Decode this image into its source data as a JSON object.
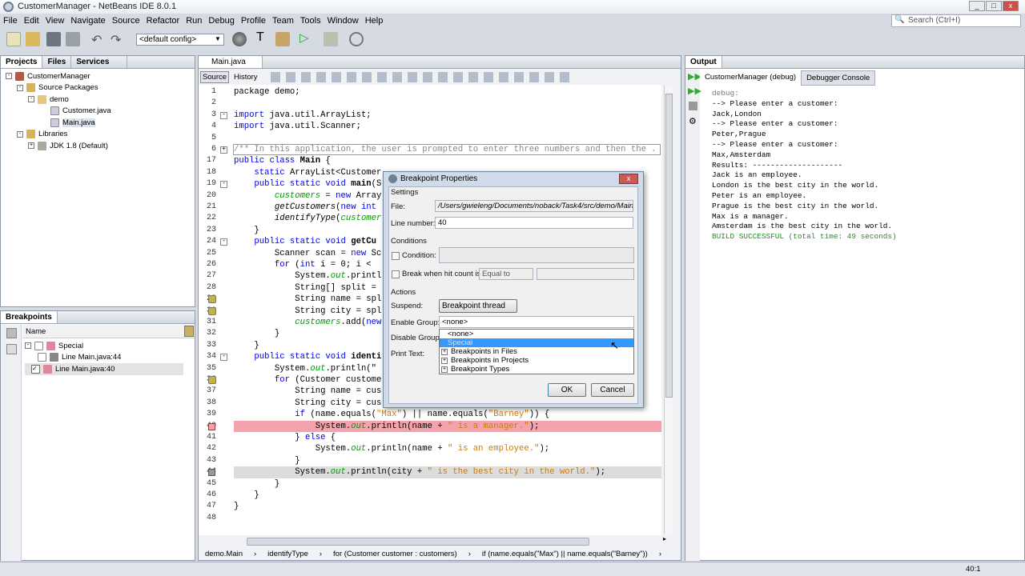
{
  "window": {
    "title": "CustomerManager - NetBeans IDE 8.0.1",
    "search_placeholder": "Search (Ctrl+I)"
  },
  "menu": [
    "File",
    "Edit",
    "View",
    "Navigate",
    "Source",
    "Refactor",
    "Run",
    "Debug",
    "Profile",
    "Team",
    "Tools",
    "Window",
    "Help"
  ],
  "toolbar": {
    "config": "<default config>"
  },
  "projects": {
    "tabs": [
      "Projects",
      "Files",
      "Services"
    ],
    "tree": [
      "CustomerManager",
      "Source Packages",
      "demo",
      "Customer.java",
      "Main.java",
      "Libraries",
      "JDK 1.8 (Default)"
    ]
  },
  "breakpoints": {
    "title": "Breakpoints",
    "column": "Name",
    "items": [
      "Special",
      "Line Main.java:44",
      "Line Main.java:40"
    ]
  },
  "editor": {
    "tab": "Main.java",
    "source_tab": "Source",
    "history_tab": "History",
    "lines": [
      {
        "n": "1",
        "s": [
          [
            "package demo;",
            ""
          ]
        ]
      },
      {
        "n": "2",
        "s": []
      },
      {
        "n": "3",
        "f": "-",
        "s": [
          [
            "import",
            "kw"
          ],
          [
            " java.util.ArrayList;",
            ""
          ]
        ]
      },
      {
        "n": "4",
        "s": [
          [
            "import",
            "kw"
          ],
          [
            " java.util.Scanner;",
            ""
          ]
        ]
      },
      {
        "n": "5",
        "s": []
      },
      {
        "n": "6",
        "f": "+",
        "box": true,
        "s": [
          [
            "/** In this application, the user is prompted to enter three numbers and then the .",
            "cm"
          ]
        ]
      },
      {
        "n": "17",
        "s": [
          [
            "public class ",
            "kw"
          ],
          [
            "Main",
            "b"
          ],
          [
            " {",
            ""
          ]
        ]
      },
      {
        "n": "18",
        "s": [
          [
            "    static ",
            "kw"
          ],
          [
            "ArrayList<Customer",
            ""
          ]
        ]
      },
      {
        "n": "19",
        "f": "-",
        "s": [
          [
            "    public static void ",
            "kw"
          ],
          [
            "main",
            "b"
          ],
          [
            "(S",
            ""
          ]
        ]
      },
      {
        "n": "20",
        "s": [
          [
            "        ",
            ""
          ],
          [
            "customers",
            "fd"
          ],
          [
            " = ",
            ""
          ],
          [
            "new",
            "kw"
          ],
          [
            " Array",
            ""
          ]
        ]
      },
      {
        "n": "21",
        "s": [
          [
            "        ",
            ""
          ],
          [
            "getCustomers",
            "it"
          ],
          [
            "(",
            ""
          ],
          [
            "new int",
            "kw"
          ]
        ]
      },
      {
        "n": "22",
        "s": [
          [
            "        ",
            ""
          ],
          [
            "identifyType",
            "it"
          ],
          [
            "(",
            ""
          ],
          [
            "customer",
            "fd"
          ]
        ]
      },
      {
        "n": "23",
        "s": [
          [
            "    }",
            ""
          ]
        ]
      },
      {
        "n": "24",
        "f": "-",
        "s": [
          [
            "    public static void ",
            "kw"
          ],
          [
            "getCu",
            "b"
          ]
        ]
      },
      {
        "n": "25",
        "s": [
          [
            "        Scanner scan = ",
            ""
          ],
          [
            "new",
            "kw"
          ],
          [
            " Sc",
            ""
          ]
        ]
      },
      {
        "n": "26",
        "s": [
          [
            "        ",
            ""
          ],
          [
            "for",
            "kw"
          ],
          [
            " (",
            ""
          ],
          [
            "int",
            "kw"
          ],
          [
            " i = 0; i < ",
            ""
          ]
        ]
      },
      {
        "n": "27",
        "s": [
          [
            "            System.",
            ""
          ],
          [
            "out",
            "fd"
          ],
          [
            ".printl",
            ""
          ]
        ]
      },
      {
        "n": "28",
        "s": [
          [
            "            String[] split = ",
            ""
          ]
        ]
      },
      {
        "n": "29",
        "g": "cond",
        "s": [
          [
            "            String name = spl",
            ""
          ]
        ]
      },
      {
        "n": "30",
        "g": "cond",
        "s": [
          [
            "            String city = spl",
            ""
          ]
        ]
      },
      {
        "n": "31",
        "s": [
          [
            "            ",
            ""
          ],
          [
            "customers",
            "fd"
          ],
          [
            ".add(",
            ""
          ],
          [
            "new",
            "kw"
          ]
        ]
      },
      {
        "n": "32",
        "s": [
          [
            "        }",
            ""
          ]
        ]
      },
      {
        "n": "33",
        "s": [
          [
            "    }",
            ""
          ]
        ]
      },
      {
        "n": "34",
        "f": "-",
        "s": [
          [
            "    public static void ",
            "kw"
          ],
          [
            "identi",
            "b"
          ]
        ]
      },
      {
        "n": "35",
        "s": [
          [
            "        System.",
            ""
          ],
          [
            "out",
            "fd"
          ],
          [
            ".println(\"",
            ""
          ]
        ]
      },
      {
        "n": "36",
        "g": "cond",
        "s": [
          [
            "        ",
            ""
          ],
          [
            "for",
            "kw"
          ],
          [
            " (Customer custome",
            ""
          ]
        ]
      },
      {
        "n": "37",
        "s": [
          [
            "            String name = cus",
            ""
          ]
        ]
      },
      {
        "n": "38",
        "s": [
          [
            "            String city = cus",
            ""
          ]
        ]
      },
      {
        "n": "39",
        "s": [
          [
            "            ",
            ""
          ],
          [
            "if",
            "kw"
          ],
          [
            " (name.equals(",
            ""
          ],
          [
            "\"Max\"",
            "st"
          ],
          [
            ") || name.equals(",
            ""
          ],
          [
            "\"Barney\"",
            "st"
          ],
          [
            ")) {",
            ""
          ]
        ]
      },
      {
        "n": "40",
        "g": "bp",
        "hl": "bp",
        "s": [
          [
            "                System.",
            ""
          ],
          [
            "out",
            "fd"
          ],
          [
            ".println(name + ",
            ""
          ],
          [
            "\" is a manager.\"",
            "st"
          ],
          [
            ");",
            ""
          ]
        ]
      },
      {
        "n": "41",
        "s": [
          [
            "            } ",
            ""
          ],
          [
            "else",
            "kw"
          ],
          [
            " {",
            ""
          ]
        ]
      },
      {
        "n": "42",
        "s": [
          [
            "                System.",
            ""
          ],
          [
            "out",
            "fd"
          ],
          [
            ".println(name + ",
            ""
          ],
          [
            "\" is an employee.\"",
            "st"
          ],
          [
            ");",
            ""
          ]
        ]
      },
      {
        "n": "43",
        "s": [
          [
            "            }",
            ""
          ]
        ]
      },
      {
        "n": "44",
        "g": "bpoff",
        "hl": "off",
        "s": [
          [
            "            System.",
            ""
          ],
          [
            "out",
            "fd"
          ],
          [
            ".println(city + ",
            ""
          ],
          [
            "\" is the best city in the world.\"",
            "st"
          ],
          [
            ");",
            ""
          ]
        ]
      },
      {
        "n": "45",
        "s": [
          [
            "        }",
            ""
          ]
        ]
      },
      {
        "n": "46",
        "s": [
          [
            "    }",
            ""
          ]
        ]
      },
      {
        "n": "47",
        "s": [
          [
            "}",
            ""
          ]
        ]
      },
      {
        "n": "48",
        "s": []
      }
    ],
    "breadcrumbs": [
      "demo.Main",
      "identifyType",
      "for (Customer customer : customers)",
      "if (name.equals(\"Max\") || name.equals(\"Barney\"))"
    ]
  },
  "dialog": {
    "title": "Breakpoint Properties",
    "settings": "Settings",
    "file_label": "File:",
    "file": "/Users/gwieleng/Documents/noback/Task4/src/demo/Main.java",
    "line_label": "Line number:",
    "line": "40",
    "conditions": "Conditions",
    "condition_label": "Condition:",
    "hitcount_label": "Break when hit count is:",
    "hitcount_op": "Equal to",
    "actions": "Actions",
    "suspend_label": "Suspend:",
    "suspend": "Breakpoint thread",
    "enable_label": "Enable Group:",
    "enable": "<none>",
    "disable_label": "Disable Group:",
    "print_label": "Print Text:",
    "options": [
      "<none>",
      "Special",
      "Breakpoints in Files",
      "Breakpoints in Projects",
      "Breakpoint Types"
    ],
    "ok": "OK",
    "cancel": "Cancel"
  },
  "output": {
    "title": "Output",
    "tabs": [
      "CustomerManager (debug)",
      "Debugger Console"
    ],
    "lines": [
      "debug:",
      "--> Please enter a customer:",
      "Jack,London",
      "--> Please enter a customer:",
      "Peter,Prague",
      "--> Please enter a customer:",
      "Max,Amsterdam",
      "Results: --------------------",
      "Jack is an employee.",
      "London is the best city in the world.",
      "Peter is an employee.",
      "Prague is the best city in the world.",
      "Max is a manager.",
      "Amsterdam is the best city in the world.",
      "BUILD SUCCESSFUL (total time: 49 seconds)"
    ]
  },
  "status": {
    "position": "40:1"
  }
}
